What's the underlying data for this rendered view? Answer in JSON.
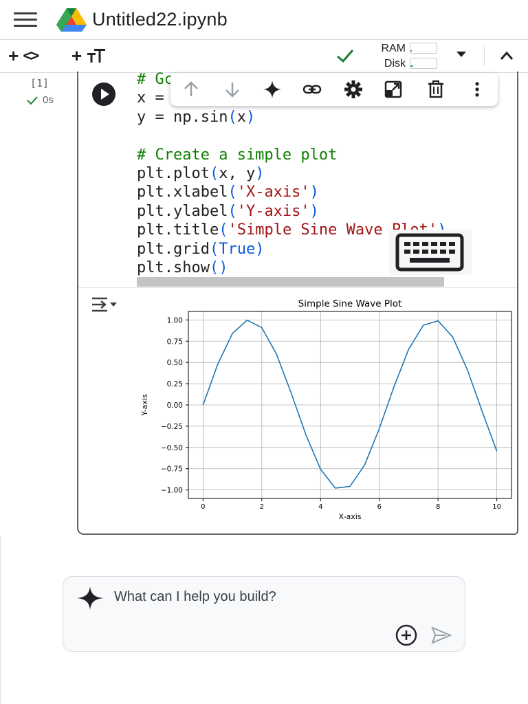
{
  "header": {
    "title": "Untitled22.ipynb"
  },
  "toolbar": {
    "add_code_symbol": "<>",
    "resources": {
      "ram_label": "RAM",
      "disk_label": "Disk",
      "ram_usage": 0.05,
      "disk_usage": 0.1
    }
  },
  "cell": {
    "execution_count": "[1]",
    "exec_time": "0s",
    "code_lines": [
      [
        {
          "t": "# Gc",
          "c": "com"
        }
      ],
      [
        {
          "t": "x = ",
          "c": ""
        }
      ],
      [
        {
          "t": "y = np.sin",
          "c": ""
        },
        {
          "t": "(",
          "c": "par"
        },
        {
          "t": "x",
          "c": ""
        },
        {
          "t": ")",
          "c": "par"
        }
      ],
      [],
      [
        {
          "t": "# Create a simple plot",
          "c": "com"
        }
      ],
      [
        {
          "t": "plt.plot",
          "c": ""
        },
        {
          "t": "(",
          "c": "par"
        },
        {
          "t": "x, y",
          "c": ""
        },
        {
          "t": ")",
          "c": "par"
        }
      ],
      [
        {
          "t": "plt.xlabel",
          "c": ""
        },
        {
          "t": "(",
          "c": "par"
        },
        {
          "t": "'X-axis'",
          "c": "str"
        },
        {
          "t": ")",
          "c": "par"
        }
      ],
      [
        {
          "t": "plt.ylabel",
          "c": ""
        },
        {
          "t": "(",
          "c": "par"
        },
        {
          "t": "'Y-axis'",
          "c": "str"
        },
        {
          "t": ")",
          "c": "par"
        }
      ],
      [
        {
          "t": "plt.title",
          "c": ""
        },
        {
          "t": "(",
          "c": "par"
        },
        {
          "t": "'Simple Sine Wave Plot'",
          "c": "str"
        },
        {
          "t": ")",
          "c": "par"
        }
      ],
      [
        {
          "t": "plt.grid",
          "c": ""
        },
        {
          "t": "(",
          "c": "par"
        },
        {
          "t": "True",
          "c": "kw"
        },
        {
          "t": ")",
          "c": "par"
        }
      ],
      [
        {
          "t": "plt.show",
          "c": ""
        },
        {
          "t": "()",
          "c": "par"
        }
      ]
    ]
  },
  "chart_data": {
    "type": "line",
    "title": "Simple Sine Wave Plot",
    "xlabel": "X-axis",
    "ylabel": "Y-axis",
    "xlim": [
      -0.5,
      10.5
    ],
    "ylim": [
      -1.1,
      1.1
    ],
    "grid": true,
    "xticks": [
      0,
      2,
      4,
      6,
      8,
      10
    ],
    "xtick_labels": [
      "0",
      "2",
      "4",
      "6",
      "8",
      "10"
    ],
    "yticks": [
      1.0,
      0.75,
      0.5,
      0.25,
      0.0,
      -0.25,
      -0.5,
      -0.75,
      -1.0
    ],
    "ytick_labels": [
      "1.00",
      "0.75",
      "0.50",
      "0.25",
      "0.00",
      "−0.25",
      "−0.50",
      "−0.75",
      "−1.00"
    ],
    "series": [
      {
        "color": "#1f77b4",
        "x": [
          0,
          0.5,
          1,
          1.5,
          2,
          2.5,
          3,
          3.5,
          4,
          4.5,
          5,
          5.5,
          6,
          6.5,
          7,
          7.5,
          8,
          8.5,
          9,
          9.5,
          10
        ],
        "y": [
          0,
          0.479,
          0.841,
          0.997,
          0.909,
          0.598,
          0.141,
          -0.351,
          -0.757,
          -0.978,
          -0.959,
          -0.706,
          -0.279,
          0.215,
          0.657,
          0.938,
          0.989,
          0.798,
          0.412,
          -0.075,
          -0.544
        ]
      }
    ]
  },
  "chat": {
    "placeholder": "What can I help you build?"
  }
}
